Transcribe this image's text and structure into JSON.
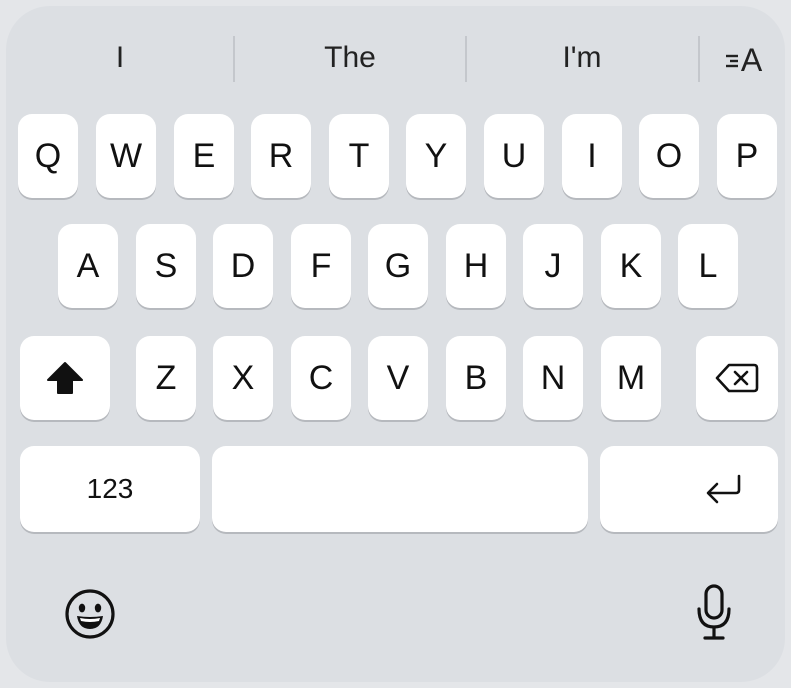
{
  "suggestions": [
    "I",
    "The",
    "I'm"
  ],
  "format_button": {
    "icon": "text-format-icon",
    "label": "A"
  },
  "rows": {
    "row1": [
      "Q",
      "W",
      "E",
      "R",
      "T",
      "Y",
      "U",
      "I",
      "O",
      "P"
    ],
    "row2": [
      "A",
      "S",
      "D",
      "F",
      "G",
      "H",
      "J",
      "K",
      "L"
    ],
    "row3": [
      "Z",
      "X",
      "C",
      "V",
      "B",
      "N",
      "M"
    ]
  },
  "special_keys": {
    "shift": {
      "icon": "shift-arrow-icon",
      "state": "active"
    },
    "delete": {
      "icon": "backspace-icon"
    },
    "numbers": {
      "label": "123"
    },
    "space": {
      "label": ""
    },
    "return": {
      "icon": "return-arrow-icon"
    },
    "emoji": {
      "icon": "emoji-face-icon"
    },
    "dictation": {
      "icon": "microphone-icon"
    }
  },
  "colors": {
    "background": "#dcdfe3",
    "key": "#ffffff",
    "text": "#111111"
  }
}
